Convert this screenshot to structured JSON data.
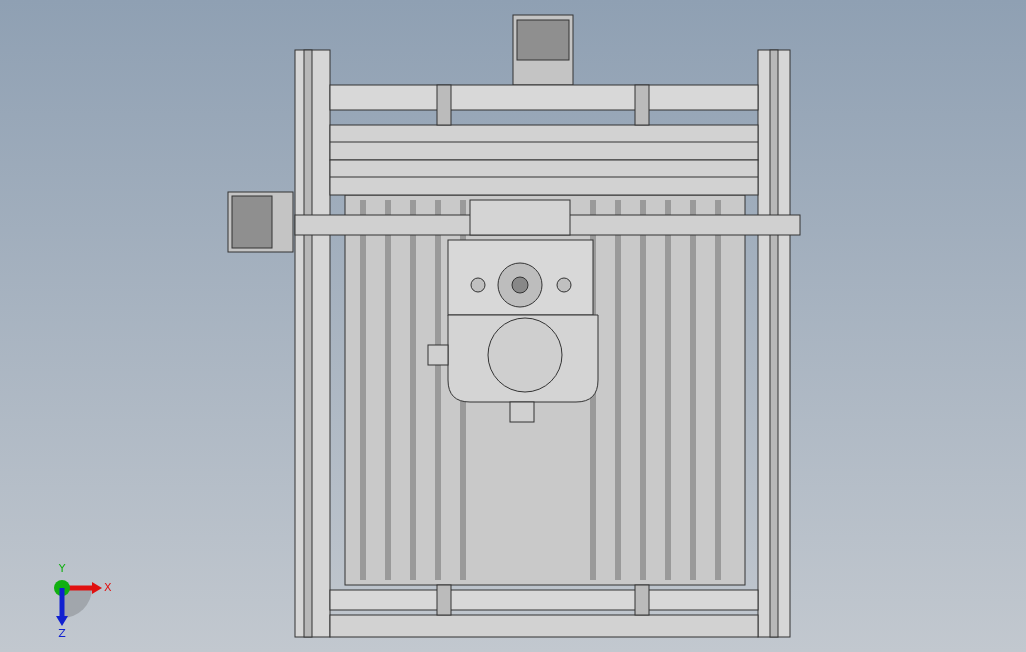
{
  "viewport": {
    "triad": {
      "axes": [
        {
          "kind": "x",
          "label": "X"
        },
        {
          "kind": "y",
          "label": "Y"
        },
        {
          "kind": "z",
          "label": "Z"
        }
      ]
    }
  }
}
